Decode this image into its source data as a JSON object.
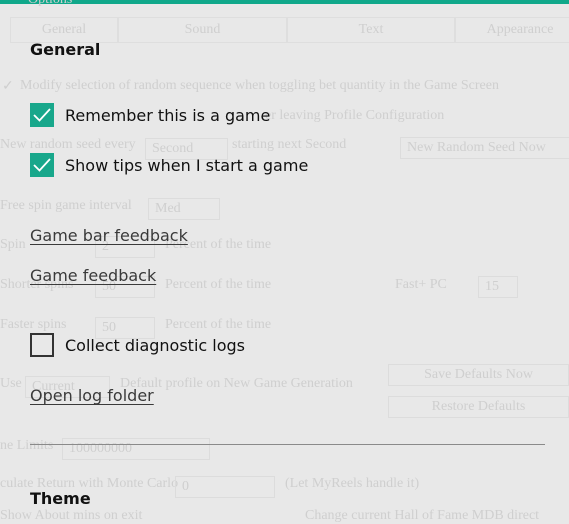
{
  "background_app": {
    "title": "Options",
    "tabs": [
      "General",
      "Sound",
      "Text",
      "Appearance"
    ],
    "rows": {
      "modify_selection": "Modify selection of random sequence when toggling bet quantity in the Game Screen",
      "profile_config": "er leaving Profile Configuration",
      "seed_label": "New random seed every",
      "seed_value": "Second",
      "seed_after": "starting next Second",
      "seed_button": "New Random Seed Now",
      "free_spin_label": "Free spin   game interval",
      "free_spin_value": "Med",
      "spin_label": "Spin",
      "spin_value": "2",
      "percent_1": "Percent of the time",
      "shorter_label": "Shorter spins",
      "shorter_value": "50",
      "percent_2": "Percent of the time",
      "fast_pc_label": "Fast+ PC",
      "fast_pc_value": "15",
      "faster_label": "Faster spins",
      "faster_value": "50",
      "percent_3": "Percent of the time",
      "use_label": "Use",
      "use_value": "Current",
      "use_after": "Default profile on New Game Generation",
      "save_defaults": "Save Defaults Now",
      "restore_defaults": "Restore Defaults",
      "limits_label": "ne Limits",
      "limits_value": "100000000",
      "monte_label": "culate Return with Monte Carlo",
      "monte_value": "0",
      "monte_after": "(Let MyReels handle it)",
      "show_about": "Show About mins on exit",
      "hall_of_fame": "Change current Hall of Fame MDB direct"
    }
  },
  "panel": {
    "accent": "#10a88a",
    "general_heading": "General",
    "remember_game": {
      "label": "Remember this is a game",
      "checked": true
    },
    "show_tips": {
      "label": "Show tips when I start a game",
      "checked": true
    },
    "game_bar_feedback": "Game bar feedback",
    "game_feedback": "Game feedback",
    "collect_logs": {
      "label": "Collect diagnostic logs",
      "checked": false
    },
    "open_log_folder": "Open log folder",
    "theme_heading": "Theme"
  }
}
